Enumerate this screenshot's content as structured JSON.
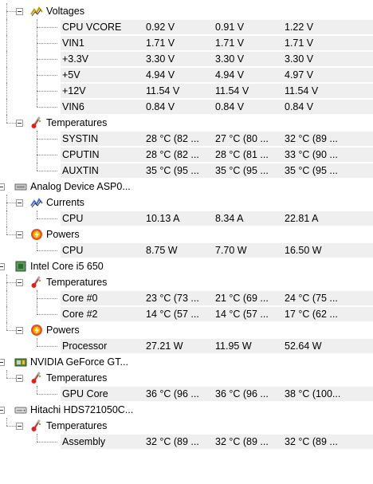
{
  "rows": [
    {
      "type": "group",
      "icon": "voltage-icon",
      "label": "Voltages",
      "level": 1,
      "last": false
    },
    {
      "type": "sensor",
      "label": "CPU VCORE",
      "values": [
        "0.92 V",
        "0.91 V",
        "1.22 V"
      ],
      "level": 2,
      "last": false
    },
    {
      "type": "sensor",
      "label": "VIN1",
      "values": [
        "1.71 V",
        "1.71 V",
        "1.71 V"
      ],
      "level": 2,
      "last": false
    },
    {
      "type": "sensor",
      "label": "+3.3V",
      "values": [
        "3.30 V",
        "3.30 V",
        "3.30 V"
      ],
      "level": 2,
      "last": false
    },
    {
      "type": "sensor",
      "label": "+5V",
      "values": [
        "4.94 V",
        "4.94 V",
        "4.97 V"
      ],
      "level": 2,
      "last": false
    },
    {
      "type": "sensor",
      "label": "+12V",
      "values": [
        "11.54 V",
        "11.54 V",
        "11.54 V"
      ],
      "level": 2,
      "last": false
    },
    {
      "type": "sensor",
      "label": "VIN6",
      "values": [
        "0.84 V",
        "0.84 V",
        "0.84 V"
      ],
      "level": 2,
      "last": true
    },
    {
      "type": "group",
      "icon": "thermometer-icon",
      "label": "Temperatures",
      "level": 1,
      "last": true
    },
    {
      "type": "sensor",
      "label": "SYSTIN",
      "values": [
        "28 °C  (82 ...",
        "27 °C  (80 ...",
        "32 °C  (89 ..."
      ],
      "level": 2,
      "last": false
    },
    {
      "type": "sensor",
      "label": "CPUTIN",
      "values": [
        "28 °C  (82 ...",
        "28 °C  (81 ...",
        "33 °C  (90 ..."
      ],
      "level": 2,
      "last": false
    },
    {
      "type": "sensor",
      "label": "AUXTIN",
      "values": [
        "35 °C  (95 ...",
        "35 °C  (95 ...",
        "35 °C  (95 ..."
      ],
      "level": 2,
      "last": true
    },
    {
      "type": "device",
      "icon": "chip-device-icon",
      "label": "Analog Device ASP0..."
    },
    {
      "type": "group",
      "icon": "current-icon",
      "label": "Currents",
      "level": 1,
      "last": false
    },
    {
      "type": "sensor",
      "label": "CPU",
      "values": [
        "10.13 A",
        "8.34 A",
        "22.81 A"
      ],
      "level": 2,
      "last": true
    },
    {
      "type": "group",
      "icon": "power-icon",
      "label": "Powers",
      "level": 1,
      "last": true
    },
    {
      "type": "sensor",
      "label": "CPU",
      "values": [
        "8.75 W",
        "7.70 W",
        "16.50 W"
      ],
      "level": 2,
      "last": true
    },
    {
      "type": "device",
      "icon": "cpu-icon",
      "label": "Intel Core i5 650"
    },
    {
      "type": "group",
      "icon": "thermometer-icon",
      "label": "Temperatures",
      "level": 1,
      "last": false
    },
    {
      "type": "sensor",
      "label": "Core #0",
      "values": [
        "23 °C  (73 ...",
        "21 °C  (69 ...",
        "24 °C  (75 ..."
      ],
      "level": 2,
      "last": false
    },
    {
      "type": "sensor",
      "label": "Core #2",
      "values": [
        "14 °C  (57 ...",
        "14 °C  (57 ...",
        "17 °C  (62 ..."
      ],
      "level": 2,
      "last": true
    },
    {
      "type": "group",
      "icon": "power-icon",
      "label": "Powers",
      "level": 1,
      "last": true
    },
    {
      "type": "sensor",
      "label": "Processor",
      "values": [
        "27.21 W",
        "11.95 W",
        "52.64 W"
      ],
      "level": 2,
      "last": true
    },
    {
      "type": "device",
      "icon": "gpu-icon",
      "label": "NVIDIA GeForce GT..."
    },
    {
      "type": "group",
      "icon": "thermometer-icon",
      "label": "Temperatures",
      "level": 1,
      "last": true
    },
    {
      "type": "sensor",
      "label": "GPU Core",
      "values": [
        "36 °C  (96 ...",
        "36 °C  (96 ...",
        "38 °C  (100..."
      ],
      "level": 2,
      "last": true
    },
    {
      "type": "device",
      "icon": "hard-drive-icon",
      "label": "Hitachi HDS721050C..."
    },
    {
      "type": "group",
      "icon": "thermometer-icon",
      "label": "Temperatures",
      "level": 1,
      "last": true
    },
    {
      "type": "sensor",
      "label": "Assembly",
      "values": [
        "32 °C  (89 ...",
        "32 °C  (89 ...",
        "32 °C  (89 ..."
      ],
      "level": 2,
      "last": true
    }
  ]
}
